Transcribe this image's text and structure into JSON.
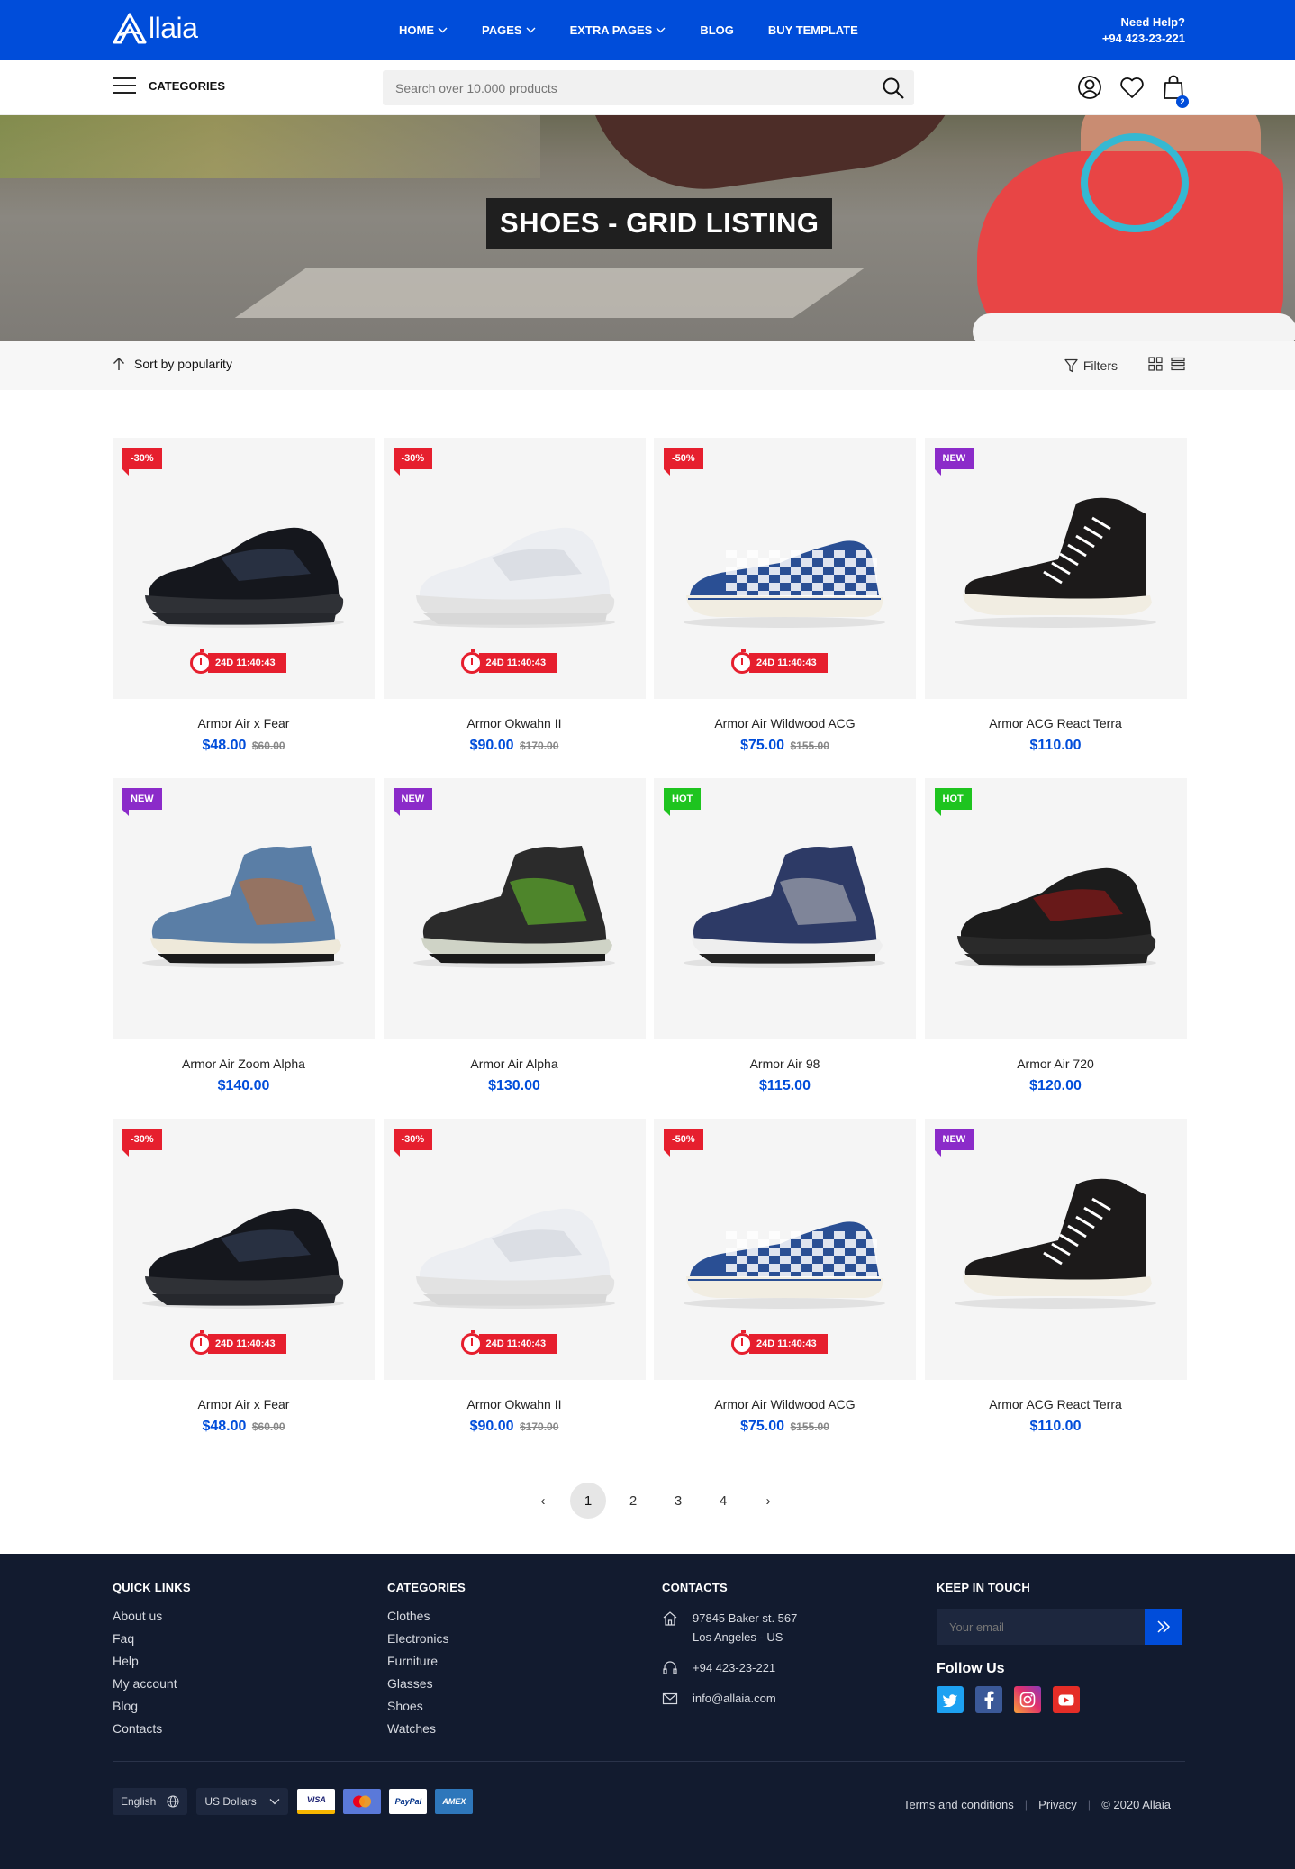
{
  "header": {
    "logo": "llaia",
    "nav": [
      "HOME",
      "PAGES",
      "EXTRA PAGES",
      "BLOG",
      "BUY TEMPLATE"
    ],
    "nav_has_dropdown": [
      true,
      true,
      true,
      false,
      false
    ],
    "help_title": "Need Help?",
    "help_phone": "+94 423-23-221"
  },
  "subbar": {
    "categories_label": "CATEGORIES",
    "search_placeholder": "Search over 10.000 products",
    "cart_count": "2"
  },
  "hero": {
    "title": "SHOES - GRID LISTING"
  },
  "toolbar": {
    "sort_label": "Sort by popularity",
    "filters_label": "Filters"
  },
  "products": [
    {
      "badge": "-30%",
      "badge_type": "red",
      "timer": "24D 11:40:43",
      "name": "Armor Air x Fear",
      "price": "$48.00",
      "old_price": "$60.00",
      "shoe": "black-runner"
    },
    {
      "badge": "-30%",
      "badge_type": "red",
      "timer": "24D 11:40:43",
      "name": "Armor Okwahn II",
      "price": "$90.00",
      "old_price": "$170.00",
      "shoe": "white-runner"
    },
    {
      "badge": "-50%",
      "badge_type": "red",
      "timer": "24D 11:40:43",
      "name": "Armor Air Wildwood ACG",
      "price": "$75.00",
      "old_price": "$155.00",
      "shoe": "checker-slipon"
    },
    {
      "badge": "NEW",
      "badge_type": "purple",
      "timer": "",
      "name": "Armor ACG React Terra",
      "price": "$110.00",
      "old_price": "",
      "shoe": "black-hightop"
    },
    {
      "badge": "NEW",
      "badge_type": "purple",
      "timer": "",
      "name": "Armor Air Zoom Alpha",
      "price": "$140.00",
      "old_price": "",
      "shoe": "denim-jordan"
    },
    {
      "badge": "NEW",
      "badge_type": "purple",
      "timer": "",
      "name": "Armor Air Alpha",
      "price": "$130.00",
      "old_price": "",
      "shoe": "black-green"
    },
    {
      "badge": "HOT",
      "badge_type": "green",
      "timer": "",
      "name": "Armor Air 98",
      "price": "$115.00",
      "old_price": "",
      "shoe": "navy-jordan"
    },
    {
      "badge": "HOT",
      "badge_type": "green",
      "timer": "",
      "name": "Armor Air 720",
      "price": "$120.00",
      "old_price": "",
      "shoe": "black-red"
    },
    {
      "badge": "-30%",
      "badge_type": "red",
      "timer": "24D 11:40:43",
      "name": "Armor Air x Fear",
      "price": "$48.00",
      "old_price": "$60.00",
      "shoe": "black-runner"
    },
    {
      "badge": "-30%",
      "badge_type": "red",
      "timer": "24D 11:40:43",
      "name": "Armor Okwahn II",
      "price": "$90.00",
      "old_price": "$170.00",
      "shoe": "white-runner"
    },
    {
      "badge": "-50%",
      "badge_type": "red",
      "timer": "24D 11:40:43",
      "name": "Armor Air Wildwood ACG",
      "price": "$75.00",
      "old_price": "$155.00",
      "shoe": "checker-slipon"
    },
    {
      "badge": "NEW",
      "badge_type": "purple",
      "timer": "",
      "name": "Armor ACG React Terra",
      "price": "$110.00",
      "old_price": "",
      "shoe": "black-hightop"
    }
  ],
  "pagination": {
    "prev": "‹",
    "pages": [
      "1",
      "2",
      "3",
      "4"
    ],
    "active": "1",
    "next": "›"
  },
  "footer": {
    "quick_links_title": "QUICK LINKS",
    "quick_links": [
      "About us",
      "Faq",
      "Help",
      "My account",
      "Blog",
      "Contacts"
    ],
    "categories_title": "CATEGORIES",
    "categories": [
      "Clothes",
      "Electronics",
      "Furniture",
      "Glasses",
      "Shoes",
      "Watches"
    ],
    "contacts_title": "CONTACTS",
    "address_line1": "97845 Baker st. 567",
    "address_line2": "Los Angeles - US",
    "phone": "+94 423-23-221",
    "email": "info@allaia.com",
    "keep_in_touch_title": "KEEP IN TOUCH",
    "email_placeholder": "Your email",
    "follow_us": "Follow Us",
    "socials": [
      "twitter-icon",
      "facebook-icon",
      "instagram-icon",
      "youtube-icon"
    ],
    "language": "English",
    "currency": "US Dollars",
    "cards": [
      "VISA",
      "mastercard",
      "PayPal",
      "AMEX"
    ],
    "terms": "Terms and conditions",
    "privacy": "Privacy",
    "copyright": "© 2020 Allaia"
  },
  "colors": {
    "brand": "#004dda",
    "sale": "#e61f2e",
    "new": "#8b2bc9",
    "hot": "#1ec41f",
    "footer_bg": "#121b2f"
  }
}
